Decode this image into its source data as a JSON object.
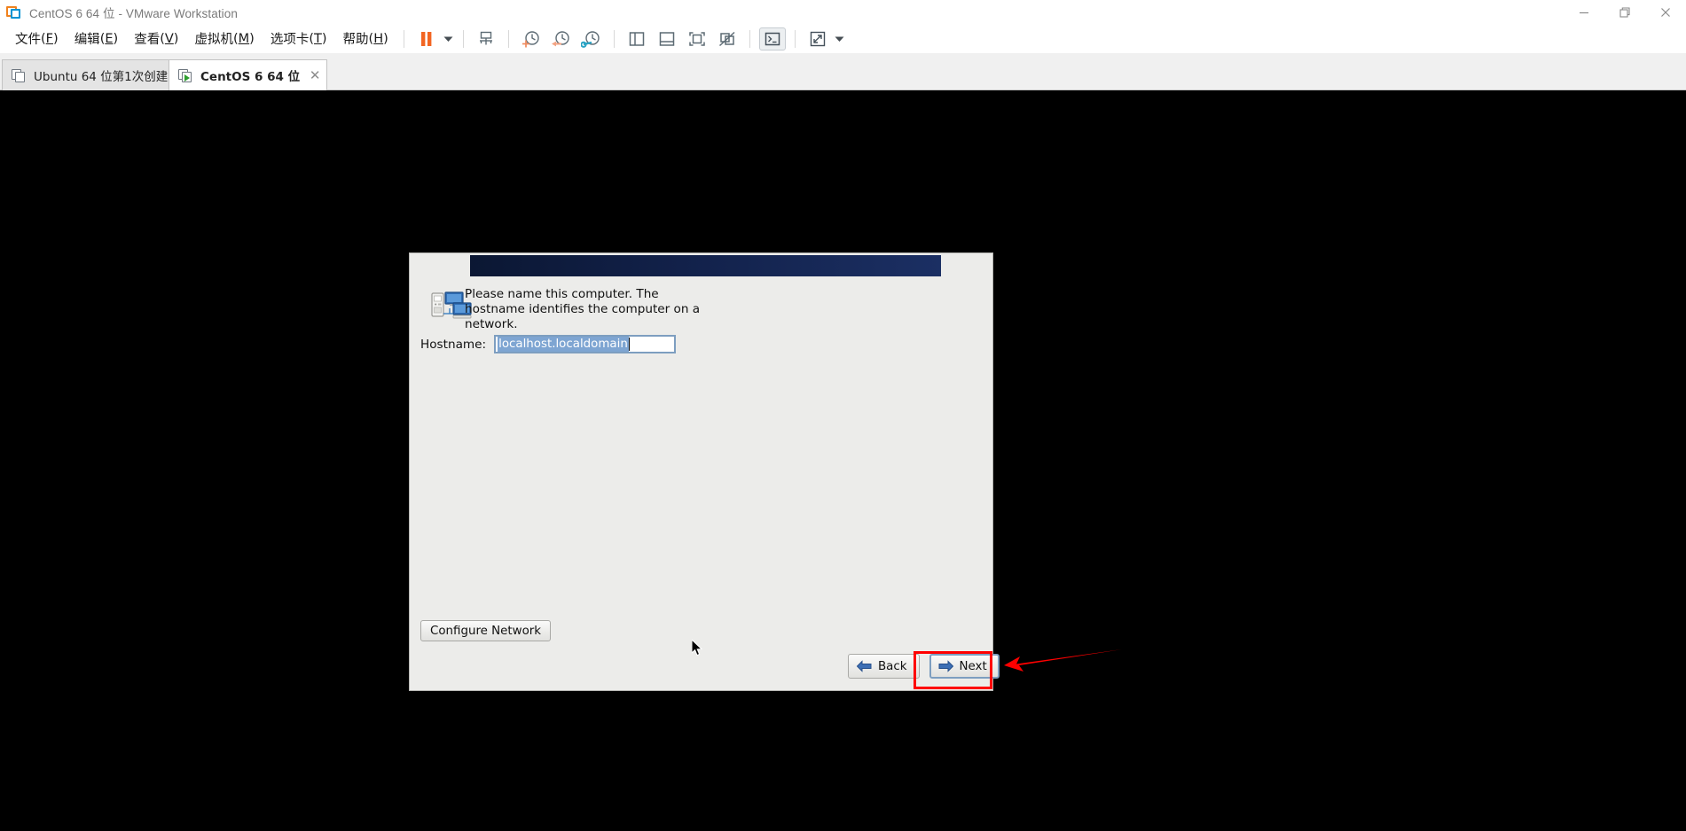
{
  "window": {
    "title": "CentOS 6 64 位 - VMware Workstation",
    "logo_icon": "vmware-logo-icon",
    "controls": [
      {
        "name": "minimize-button",
        "icon": "minimize-icon",
        "label": "—"
      },
      {
        "name": "restore-button",
        "icon": "restore-icon",
        "label": "❐"
      },
      {
        "name": "close-button",
        "icon": "close-icon",
        "label": "✕"
      }
    ]
  },
  "menubar": {
    "items": [
      {
        "label": "文件",
        "accel": "F"
      },
      {
        "label": "编辑",
        "accel": "E"
      },
      {
        "label": "查看",
        "accel": "V"
      },
      {
        "label": "虚拟机",
        "accel": "M"
      },
      {
        "label": "选项卡",
        "accel": "T"
      },
      {
        "label": "帮助",
        "accel": "H"
      }
    ]
  },
  "toolbar": {
    "buttons": [
      {
        "name": "suspend-button",
        "icon": "pause-icon",
        "selected": false
      },
      {
        "name": "power-dropdown",
        "icon": "chevron-down-icon",
        "selected": false
      },
      {
        "name": "manage-vm-button",
        "icon": "network-device-icon",
        "selected": false
      },
      {
        "name": "take-snapshot-button",
        "icon": "clock-plus-icon",
        "selected": false
      },
      {
        "name": "revert-snapshot-button",
        "icon": "clock-back-icon",
        "selected": false
      },
      {
        "name": "snapshot-manager-button",
        "icon": "clock-wrench-icon",
        "selected": false
      },
      {
        "name": "show-library-button",
        "icon": "panel-left-icon",
        "selected": false
      },
      {
        "name": "show-thumbnails-button",
        "icon": "panel-bottom-icon",
        "selected": false
      },
      {
        "name": "show-console-view-button",
        "icon": "fit-guest-icon",
        "selected": false
      },
      {
        "name": "hide-console-view-button",
        "icon": "fit-guest-off-icon",
        "selected": false
      },
      {
        "name": "console-terminal-button",
        "icon": "terminal-icon",
        "selected": true
      },
      {
        "name": "fullscreen-button",
        "icon": "fullscreen-icon",
        "selected": false
      },
      {
        "name": "fullscreen-dropdown",
        "icon": "chevron-down-icon",
        "selected": false
      }
    ]
  },
  "tabs": [
    {
      "name": "tab-ubuntu",
      "label": "Ubuntu 64 位第1次创建",
      "active": false,
      "running": false,
      "close_label": "✕"
    },
    {
      "name": "tab-centos",
      "label": "CentOS 6 64 位",
      "active": true,
      "running": true,
      "close_label": "✕"
    }
  ],
  "dialog": {
    "title_banner": "",
    "icon": "computer-network-icon",
    "description": "Please name this computer.  The hostname identifies the computer on a network.",
    "hostname_label": "Hostname:",
    "hostname_value": "localhost.localdomain",
    "hostname_placeholder": "localhost.localdomain",
    "configure_network_label": "Configure Network",
    "back_label": "Back",
    "next_label": "Next"
  },
  "annotations": {
    "highlight_color": "#ff0000",
    "arrow_color": "#ff0000",
    "target": "next-button"
  }
}
